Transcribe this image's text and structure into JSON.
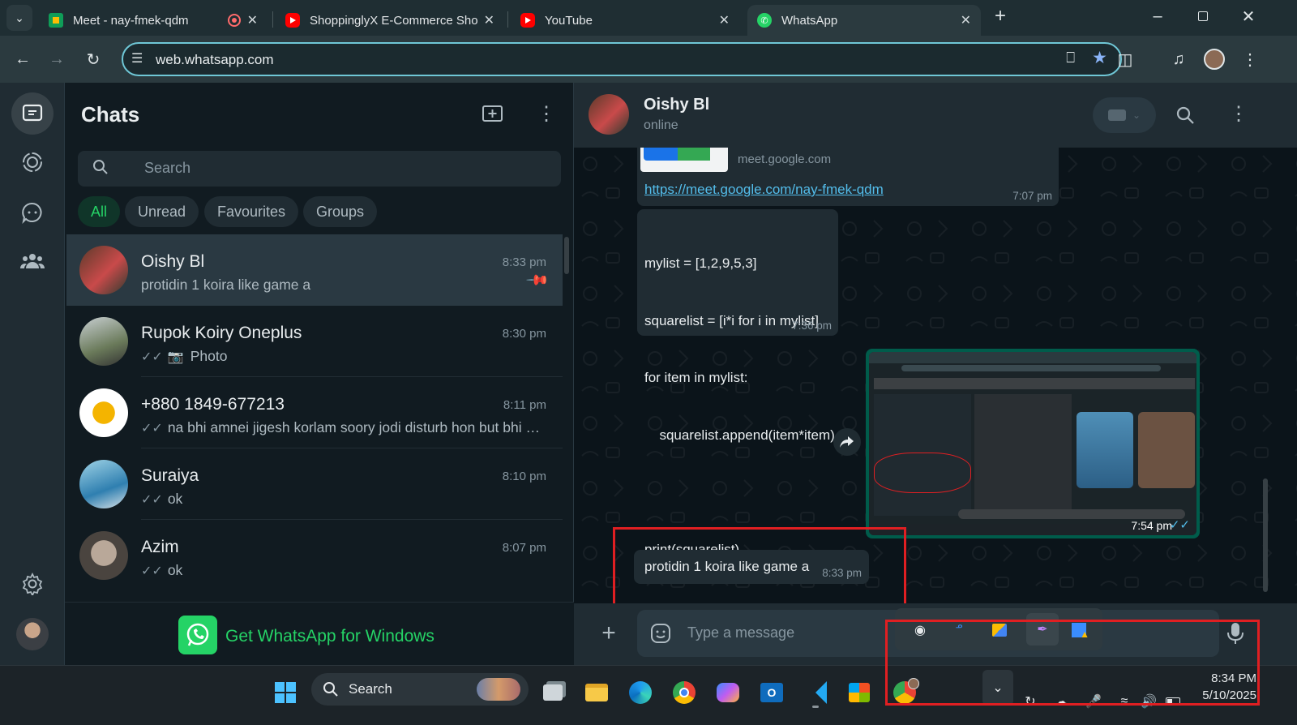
{
  "browser": {
    "tabs": [
      {
        "title": "Meet - nay-fmek-qdm"
      },
      {
        "title": "ShoppinglyX E-Commerce Shop"
      },
      {
        "title": "YouTube"
      },
      {
        "title": "WhatsApp"
      }
    ],
    "url": "web.whatsapp.com"
  },
  "sidebar": {
    "title": "Chats",
    "search_placeholder": "Search",
    "filters": [
      "All",
      "Unread",
      "Favourites",
      "Groups"
    ]
  },
  "chats": [
    {
      "name": "Oishy Bl",
      "time": "8:33 pm",
      "preview": "protidin 1 koira like game a",
      "ticks": "",
      "pinned": true
    },
    {
      "name": "Rupok Koiry Oneplus",
      "time": "8:30 pm",
      "preview": "Photo",
      "ticks": "✓✓",
      "photo": true
    },
    {
      "name": "+880 1849-677213",
      "time": "8:11 pm",
      "preview": "na bhi amnei jigesh korlam soory jodi disturb hon but bhi ai...",
      "ticks": "✓✓"
    },
    {
      "name": "Suraiya",
      "time": "8:10 pm",
      "preview": "ok",
      "ticks": "✓✓"
    },
    {
      "name": "Azim",
      "time": "8:07 pm",
      "preview": "ok",
      "ticks": "✓✓"
    }
  ],
  "get_app": "Get WhatsApp for Windows",
  "conversation": {
    "contact_name": "Oishy Bl",
    "status": "online",
    "link_domain": "meet.google.com",
    "link_url": "https://meet.google.com/nay-fmek-qdm",
    "link_time": "7:07 pm",
    "code_lines": [
      "mylist = [1,2,9,5,3]",
      "squarelist = [i*i for i in mylist]",
      "for item in mylist:",
      "  squarelist.append(item*item)",
      "",
      "print(squarelist)"
    ],
    "code_time": "7:36 pm",
    "image_time": "7:54 pm",
    "last_message": "protidin 1 koira like game a",
    "last_time": "8:33 pm",
    "composer_placeholder": "Type a message"
  },
  "taskbar": {
    "search": "Search",
    "time": "8:34 PM",
    "date": "5/10/2025"
  }
}
